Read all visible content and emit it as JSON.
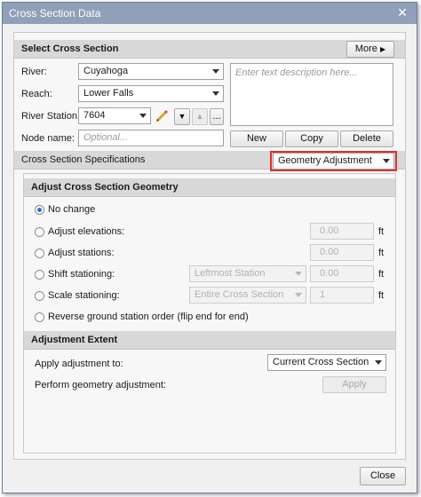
{
  "window": {
    "title": "Cross Section Data",
    "close_glyph": "✕"
  },
  "select_section": {
    "header": "Select Cross Section",
    "more_label": "More",
    "more_glyph": "▶",
    "river_label": "River:",
    "river_value": "Cuyahoga",
    "reach_label": "Reach:",
    "reach_value": "Lower Falls",
    "station_label": "River Station:",
    "station_value": "7604",
    "step_down_glyph": "▼",
    "step_up_glyph": "▲",
    "browse_label": "...",
    "node_label": "Node name:",
    "node_placeholder": "Optional...",
    "description_placeholder": "Enter text description here...",
    "new_label": "New",
    "copy_label": "Copy",
    "delete_label": "Delete"
  },
  "specifications": {
    "header": "Cross Section Specifications",
    "mode_value": "Geometry Adjustment"
  },
  "adjust_geometry": {
    "header": "Adjust Cross Section Geometry",
    "no_change_label": "No change",
    "adjust_elevations_label": "Adjust elevations:",
    "adjust_elevations_value": "0.00",
    "adjust_stations_label": "Adjust stations:",
    "adjust_stations_value": "0.00",
    "shift_label": "Shift stationing:",
    "shift_mode": "Leftmost Station",
    "shift_value": "0.00",
    "scale_label": "Scale stationing:",
    "scale_mode": "Entire Cross Section",
    "scale_value": "1",
    "reverse_label": "Reverse ground station order (flip end for end)",
    "unit_ft": "ft"
  },
  "adjustment_extent": {
    "header": "Adjustment Extent",
    "apply_to_label": "Apply adjustment to:",
    "apply_to_value": "Current Cross Section",
    "perform_label": "Perform geometry adjustment:",
    "apply_button": "Apply"
  },
  "footer": {
    "close_label": "Close"
  },
  "colors": {
    "accent": "#2f6fd6",
    "highlight": "#d83131",
    "titlebar": "#8fa0b8"
  }
}
